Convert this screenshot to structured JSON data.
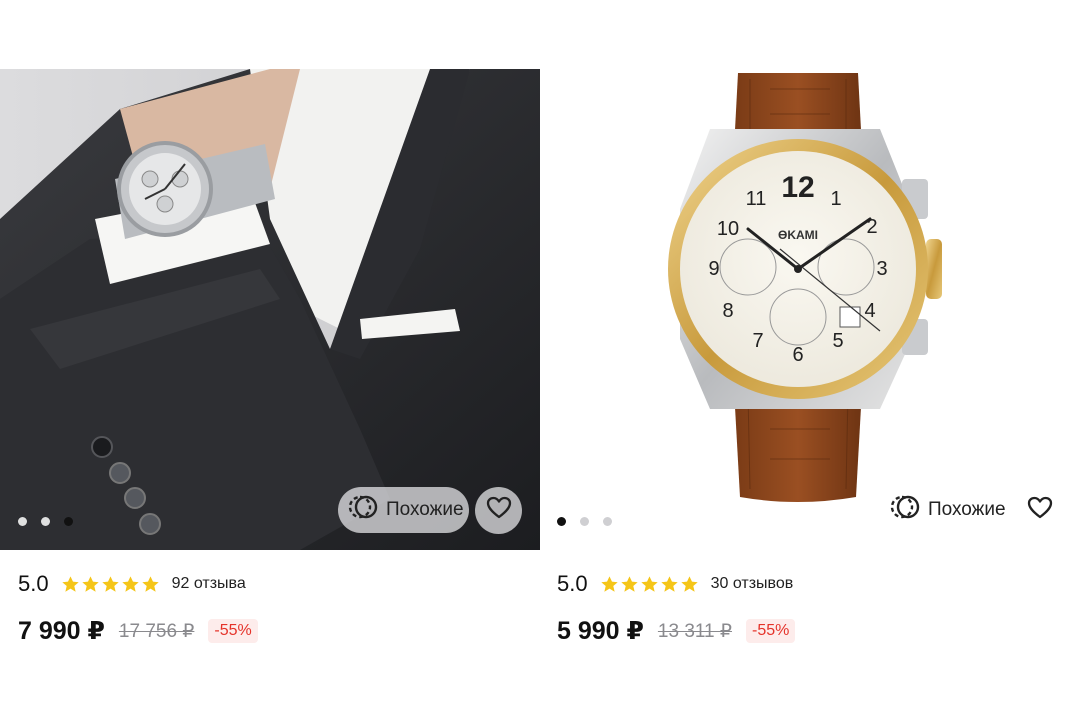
{
  "products": [
    {
      "image_alt": "",
      "similar_label": "Похожие",
      "rating": "5.0",
      "stars": 5,
      "reviews": "92 отзыва",
      "price": "7 990 ₽",
      "old_price": "17 756 ₽",
      "discount": "-55%",
      "dots_total": 3,
      "dots_active": 2
    },
    {
      "image_alt": "",
      "brand_on_dial": "ƟKAMI",
      "similar_label": "Похожие",
      "rating": "5.0",
      "stars": 5,
      "reviews": "30 отзывов",
      "price": "5 990 ₽",
      "old_price": "13 311 ₽",
      "discount": "-55%",
      "dots_total": 3,
      "dots_active": 0
    }
  ],
  "colors": {
    "star": "#f5c518",
    "discount_text": "#e5332a",
    "discount_bg": "#fdeceb",
    "price": "#111111",
    "old_price": "#8a8a8e"
  },
  "icons": {
    "similar": "similar-icon",
    "favorite": "heart-icon",
    "rating_star": "star-icon"
  }
}
